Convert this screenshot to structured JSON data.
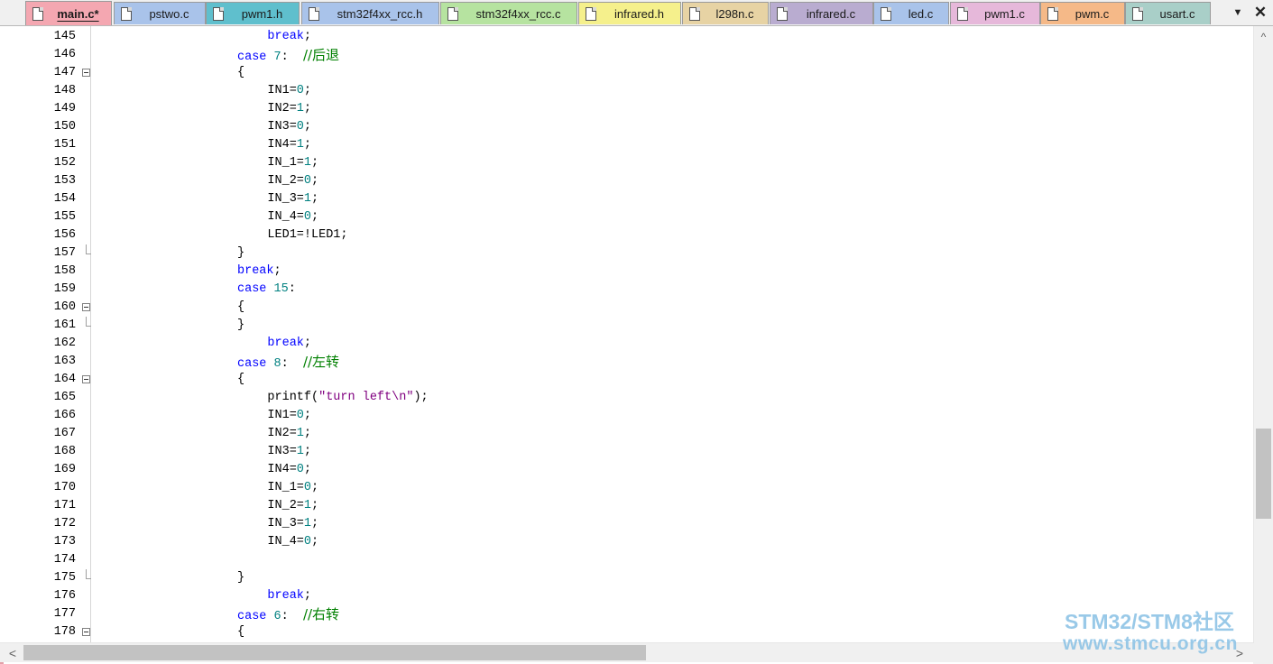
{
  "tabs": [
    {
      "label": "main.c*",
      "color": "#f4a7b1",
      "active": true
    },
    {
      "label": "pstwo.c",
      "color": "#a9c3ea"
    },
    {
      "label": "pwm1.h",
      "color": "#5fbfcd"
    },
    {
      "label": "stm32f4xx_rcc.h",
      "color": "#a9c3ea"
    },
    {
      "label": "stm32f4xx_rcc.c",
      "color": "#b6e3a0"
    },
    {
      "label": "infrared.h",
      "color": "#f5f08c"
    },
    {
      "label": "l298n.c",
      "color": "#e7d3a4"
    },
    {
      "label": "infrared.c",
      "color": "#b9acd0"
    },
    {
      "label": "led.c",
      "color": "#a9c3ea"
    },
    {
      "label": "pwm1.c",
      "color": "#e6b8da"
    },
    {
      "label": "pwm.c",
      "color": "#f5b988"
    },
    {
      "label": "usart.c",
      "color": "#a9cfc8"
    }
  ],
  "tab_controls": {
    "menu_icon": "▼",
    "close_icon": "✕"
  },
  "scroll": {
    "up": "^",
    "left": "<",
    "right": ">"
  },
  "code_lines": [
    {
      "n": "145",
      "indent": 12,
      "fold": "",
      "parts": [
        [
          "kw",
          "break"
        ],
        [
          "",
          ";"
        ]
      ]
    },
    {
      "n": "146",
      "indent": 8,
      "fold": "",
      "parts": [
        [
          "kw",
          "case"
        ],
        [
          "",
          " "
        ],
        [
          "num",
          "7"
        ],
        [
          "",
          ":  "
        ],
        [
          "cmt",
          "//后退"
        ]
      ]
    },
    {
      "n": "147",
      "indent": 8,
      "fold": "open",
      "parts": [
        [
          "",
          "{"
        ]
      ]
    },
    {
      "n": "148",
      "indent": 12,
      "fold": "",
      "parts": [
        [
          "",
          "IN1="
        ],
        [
          "num",
          "0"
        ],
        [
          "",
          ";"
        ]
      ]
    },
    {
      "n": "149",
      "indent": 12,
      "fold": "",
      "parts": [
        [
          "",
          "IN2="
        ],
        [
          "num",
          "1"
        ],
        [
          "",
          ";"
        ]
      ]
    },
    {
      "n": "150",
      "indent": 12,
      "fold": "",
      "parts": [
        [
          "",
          "IN3="
        ],
        [
          "num",
          "0"
        ],
        [
          "",
          ";"
        ]
      ]
    },
    {
      "n": "151",
      "indent": 12,
      "fold": "",
      "parts": [
        [
          "",
          "IN4="
        ],
        [
          "num",
          "1"
        ],
        [
          "",
          ";"
        ]
      ]
    },
    {
      "n": "152",
      "indent": 12,
      "fold": "",
      "parts": [
        [
          "",
          "IN_1="
        ],
        [
          "num",
          "1"
        ],
        [
          "",
          ";"
        ]
      ]
    },
    {
      "n": "153",
      "indent": 12,
      "fold": "",
      "parts": [
        [
          "",
          "IN_2="
        ],
        [
          "num",
          "0"
        ],
        [
          "",
          ";"
        ]
      ]
    },
    {
      "n": "154",
      "indent": 12,
      "fold": "",
      "parts": [
        [
          "",
          "IN_3="
        ],
        [
          "num",
          "1"
        ],
        [
          "",
          ";"
        ]
      ]
    },
    {
      "n": "155",
      "indent": 12,
      "fold": "",
      "parts": [
        [
          "",
          "IN_4="
        ],
        [
          "num",
          "0"
        ],
        [
          "",
          ";"
        ]
      ]
    },
    {
      "n": "156",
      "indent": 12,
      "fold": "",
      "parts": [
        [
          "",
          "LED1=!LED1;"
        ]
      ]
    },
    {
      "n": "157",
      "indent": 8,
      "fold": "end",
      "parts": [
        [
          "",
          "}"
        ]
      ]
    },
    {
      "n": "158",
      "indent": 8,
      "fold": "",
      "parts": [
        [
          "kw",
          "break"
        ],
        [
          "",
          ";"
        ]
      ]
    },
    {
      "n": "159",
      "indent": 8,
      "fold": "",
      "parts": [
        [
          "kw",
          "case"
        ],
        [
          "",
          " "
        ],
        [
          "num",
          "15"
        ],
        [
          "",
          ":"
        ]
      ]
    },
    {
      "n": "160",
      "indent": 8,
      "fold": "open",
      "parts": [
        [
          "",
          "{"
        ]
      ]
    },
    {
      "n": "161",
      "indent": 8,
      "fold": "end",
      "parts": [
        [
          "",
          "}"
        ]
      ]
    },
    {
      "n": "162",
      "indent": 12,
      "fold": "",
      "parts": [
        [
          "kw",
          "break"
        ],
        [
          "",
          ";"
        ]
      ]
    },
    {
      "n": "163",
      "indent": 8,
      "fold": "",
      "parts": [
        [
          "kw",
          "case"
        ],
        [
          "",
          " "
        ],
        [
          "num",
          "8"
        ],
        [
          "",
          ":  "
        ],
        [
          "cmt",
          "//左转"
        ]
      ]
    },
    {
      "n": "164",
      "indent": 8,
      "fold": "open",
      "parts": [
        [
          "",
          "{"
        ]
      ]
    },
    {
      "n": "165",
      "indent": 12,
      "fold": "",
      "parts": [
        [
          "",
          "printf("
        ],
        [
          "str",
          "\"turn left\\n\""
        ],
        [
          "",
          ");"
        ]
      ]
    },
    {
      "n": "166",
      "indent": 12,
      "fold": "",
      "parts": [
        [
          "",
          "IN1="
        ],
        [
          "num",
          "0"
        ],
        [
          "",
          ";"
        ]
      ]
    },
    {
      "n": "167",
      "indent": 12,
      "fold": "",
      "parts": [
        [
          "",
          "IN2="
        ],
        [
          "num",
          "1"
        ],
        [
          "",
          ";"
        ]
      ]
    },
    {
      "n": "168",
      "indent": 12,
      "fold": "",
      "parts": [
        [
          "",
          "IN3="
        ],
        [
          "num",
          "1"
        ],
        [
          "",
          ";"
        ]
      ]
    },
    {
      "n": "169",
      "indent": 12,
      "fold": "",
      "parts": [
        [
          "",
          "IN4="
        ],
        [
          "num",
          "0"
        ],
        [
          "",
          ";"
        ]
      ]
    },
    {
      "n": "170",
      "indent": 12,
      "fold": "",
      "parts": [
        [
          "",
          "IN_1="
        ],
        [
          "num",
          "0"
        ],
        [
          "",
          ";"
        ]
      ]
    },
    {
      "n": "171",
      "indent": 12,
      "fold": "",
      "parts": [
        [
          "",
          "IN_2="
        ],
        [
          "num",
          "1"
        ],
        [
          "",
          ";"
        ]
      ]
    },
    {
      "n": "172",
      "indent": 12,
      "fold": "",
      "parts": [
        [
          "",
          "IN_3="
        ],
        [
          "num",
          "1"
        ],
        [
          "",
          ";"
        ]
      ]
    },
    {
      "n": "173",
      "indent": 12,
      "fold": "",
      "parts": [
        [
          "",
          "IN_4="
        ],
        [
          "num",
          "0"
        ],
        [
          "",
          ";"
        ]
      ]
    },
    {
      "n": "174",
      "indent": 0,
      "fold": "",
      "parts": []
    },
    {
      "n": "175",
      "indent": 8,
      "fold": "end",
      "parts": [
        [
          "",
          "}"
        ]
      ]
    },
    {
      "n": "176",
      "indent": 12,
      "fold": "",
      "parts": [
        [
          "kw",
          "break"
        ],
        [
          "",
          ";"
        ]
      ]
    },
    {
      "n": "177",
      "indent": 8,
      "fold": "",
      "parts": [
        [
          "kw",
          "case"
        ],
        [
          "",
          " "
        ],
        [
          "num",
          "6"
        ],
        [
          "",
          ":  "
        ],
        [
          "cmt",
          "//右转"
        ]
      ]
    },
    {
      "n": "178",
      "indent": 8,
      "fold": "open",
      "parts": [
        [
          "",
          "{"
        ]
      ]
    }
  ],
  "watermark": {
    "line1": "STM32/STM8社区",
    "line2": "www.stmcu.org.cn"
  }
}
